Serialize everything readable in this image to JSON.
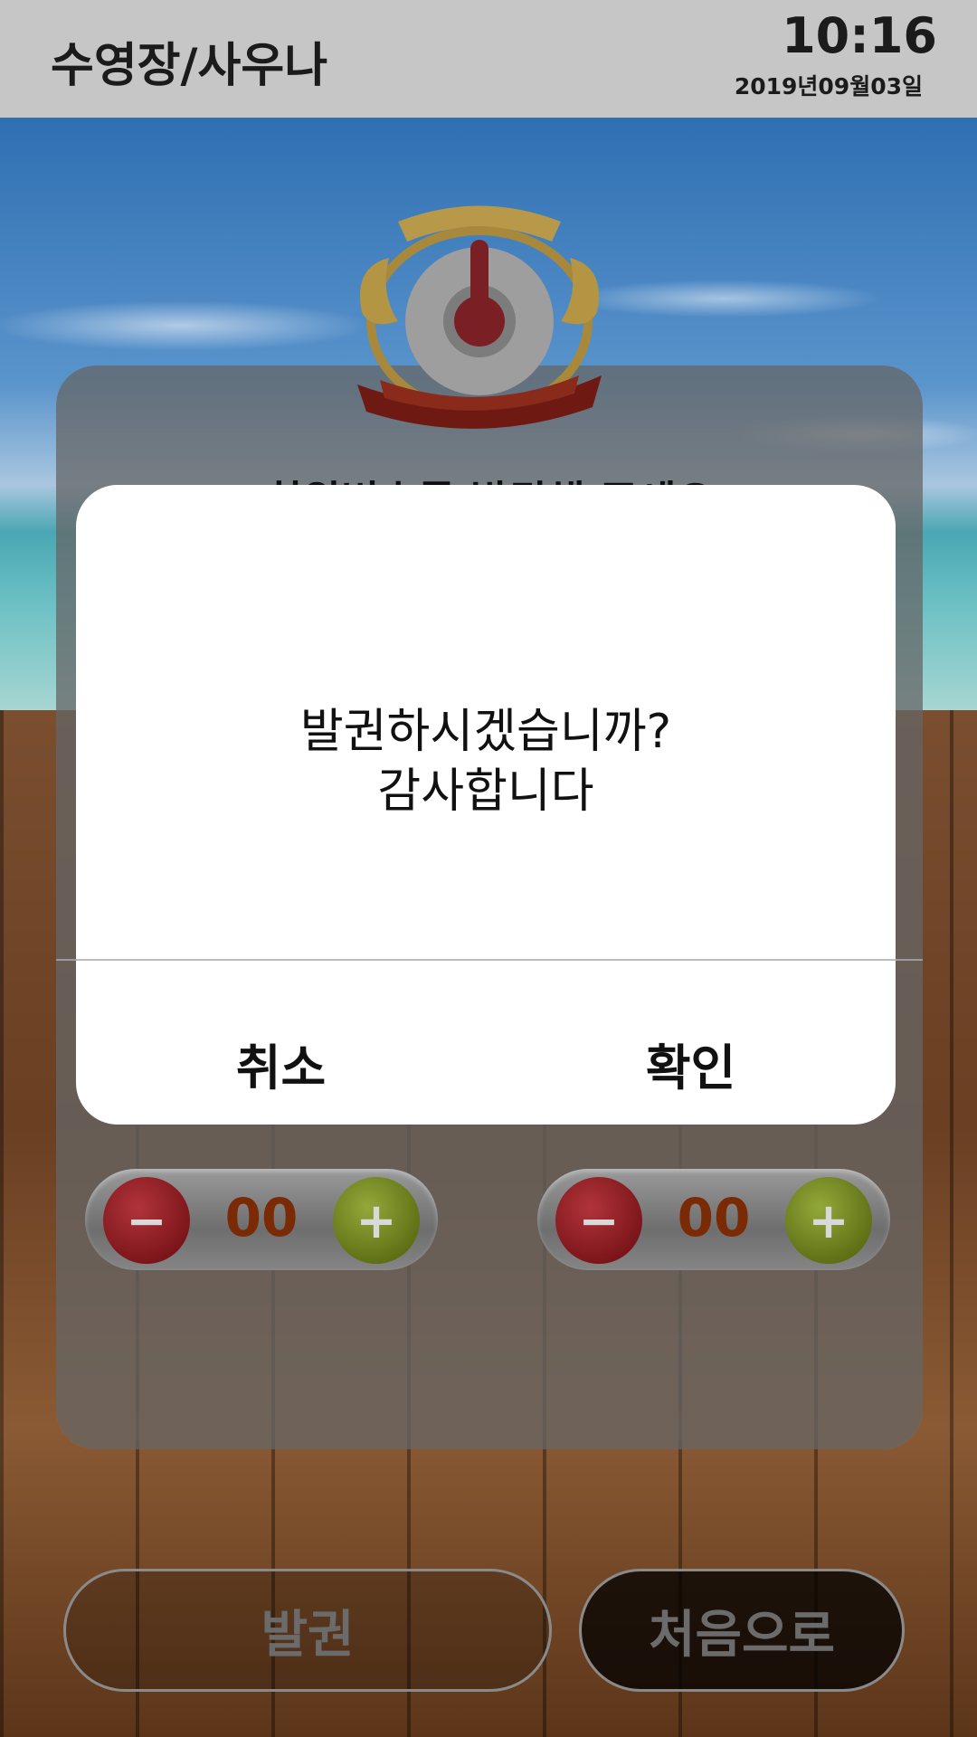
{
  "header": {
    "title": "수영장/사우나",
    "time": "10:16",
    "date": "2019년09월03일"
  },
  "card": {
    "heading": "회원번호를 발권해 주세요"
  },
  "steppers": [
    {
      "count": "00",
      "minus": "−",
      "plus": "+"
    },
    {
      "count": "00",
      "minus": "−",
      "plus": "+"
    }
  ],
  "buttons": {
    "issue": "발권",
    "home": "처음으로"
  },
  "modal": {
    "message_line1": "발권하시겠습니까?",
    "message_line2": "감사합니다",
    "cancel": "취소",
    "confirm": "확인"
  },
  "icons": {
    "emblem": "thermometer-emblem-icon"
  },
  "colors": {
    "header_bg": "#c6c6c6",
    "minus": "#8e1c22",
    "plus": "#6f801e",
    "count": "#7a2a05"
  }
}
